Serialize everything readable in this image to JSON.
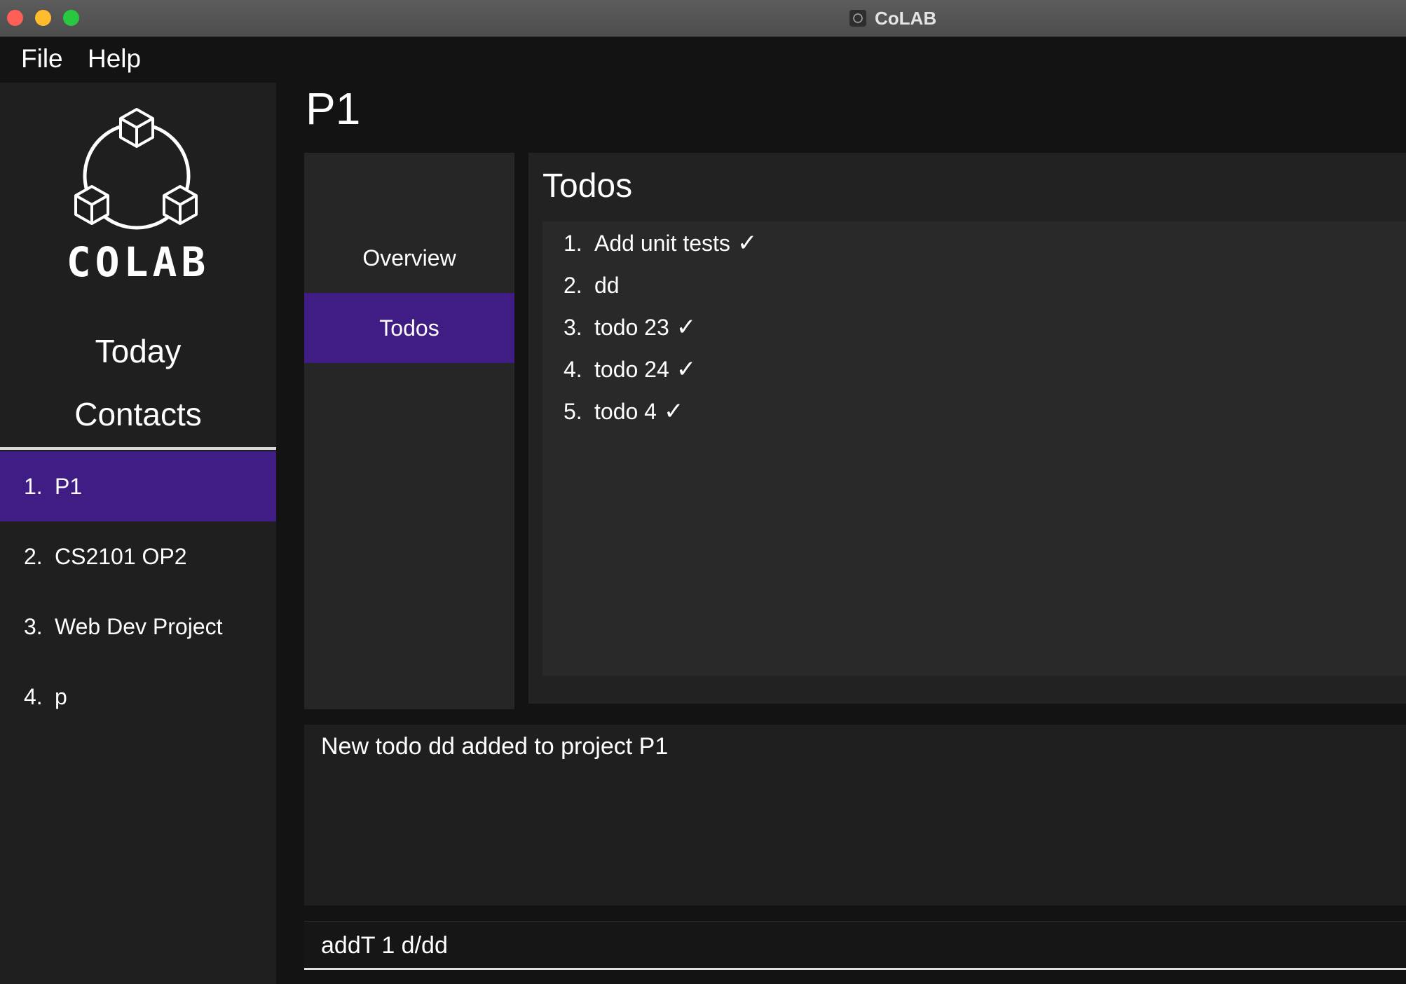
{
  "window": {
    "title": "CoLAB",
    "app_icon": "colab-app-icon"
  },
  "menu": {
    "items": [
      "File",
      "Help"
    ]
  },
  "sidebar": {
    "brand": "COLAB",
    "nav": [
      "Today",
      "Contacts"
    ],
    "projects": [
      {
        "num": "1.",
        "name": "P1",
        "selected": true
      },
      {
        "num": "2.",
        "name": "CS2101 OP2",
        "selected": false
      },
      {
        "num": "3.",
        "name": "Web Dev Project",
        "selected": false
      },
      {
        "num": "4.",
        "name": "p",
        "selected": false
      }
    ]
  },
  "main": {
    "title": "P1",
    "tabs": [
      {
        "label": "Overview",
        "active": false
      },
      {
        "label": "Todos",
        "active": true
      }
    ],
    "todos_title": "Todos",
    "todos": [
      {
        "num": "1.",
        "text": "Add unit tests",
        "done": true
      },
      {
        "num": "2.",
        "text": "dd",
        "done": false
      },
      {
        "num": "3.",
        "text": "todo 23",
        "done": true
      },
      {
        "num": "4.",
        "text": "todo 24",
        "done": true
      },
      {
        "num": "5.",
        "text": "todo 4",
        "done": true
      }
    ],
    "check_mark": "✓",
    "result_text": "New todo dd added to project P1",
    "command_value": "addT 1 d/dd"
  },
  "colors": {
    "accent": "#3f1d84",
    "background": "#131313",
    "panel": "#1f1f1f"
  }
}
